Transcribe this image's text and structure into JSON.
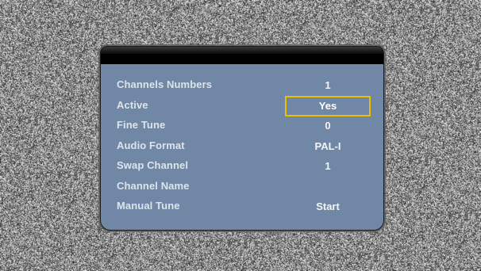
{
  "menu": {
    "title": "",
    "rows": [
      {
        "label": "Channels Numbers",
        "value": "1"
      },
      {
        "label": "Active",
        "value": "Yes",
        "selected": true
      },
      {
        "label": "Fine Tune",
        "value": "0"
      },
      {
        "label": "Audio Format",
        "value": "PAL-I"
      },
      {
        "label": "Swap Channel",
        "value": "1"
      },
      {
        "label": "Channel Name",
        "value": ""
      },
      {
        "label": "Manual Tune",
        "value": "Start"
      }
    ]
  },
  "colors": {
    "panel_background": "#7088a5",
    "title_bar": "#000000",
    "selection_border": "#e8c000",
    "text": "#dde4ec"
  }
}
